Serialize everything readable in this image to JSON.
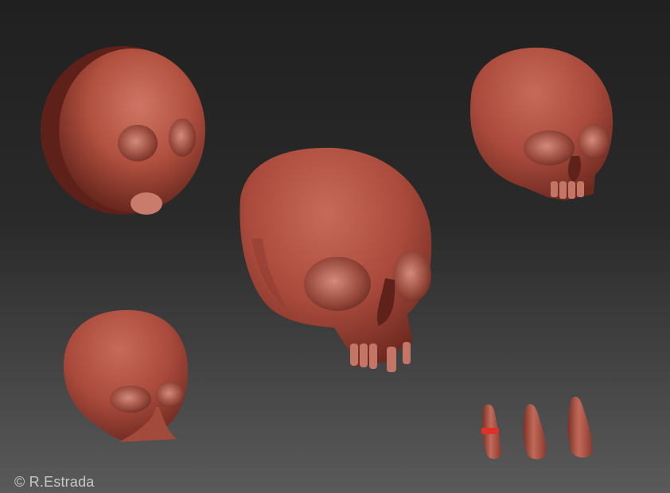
{
  "credit": {
    "text": "© R.Estrada"
  },
  "stages": [
    {
      "id": "sphere",
      "icon": "sphere-blockout-icon"
    },
    {
      "id": "small_skull",
      "icon": "rough-skull-icon"
    },
    {
      "id": "large_skull",
      "icon": "detailed-skull-icon"
    },
    {
      "id": "finished_skull",
      "icon": "finished-skull-icon"
    },
    {
      "id": "teeth",
      "icon": "tooth-icon",
      "count": 3
    }
  ],
  "colors": {
    "background_top": "#202020",
    "background_bottom": "#5a5a5a",
    "clay_light": "#c96a5a",
    "clay_mid": "#a9473a",
    "clay_dark": "#5d2119",
    "cavity": "#7a3529",
    "credit_text": "#c7c7c7",
    "tooth_band": "#e0302a"
  }
}
